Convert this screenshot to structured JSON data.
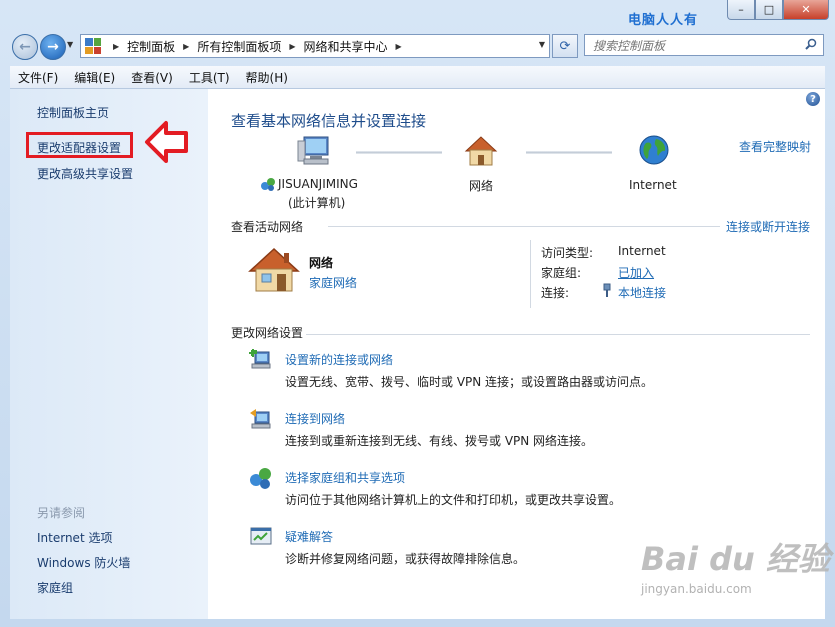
{
  "titlebar": {
    "watermark": "电脑人人有",
    "min": "–",
    "max": "□",
    "close": "✕"
  },
  "address": {
    "crumbs": [
      "控制面板",
      "所有控制面板项",
      "网络和共享中心"
    ]
  },
  "search": {
    "placeholder": "搜索控制面板"
  },
  "menu": [
    "文件(F)",
    "编辑(E)",
    "查看(V)",
    "工具(T)",
    "帮助(H)"
  ],
  "sidebar": {
    "home": "控制面板主页",
    "adapter": "更改适配器设置",
    "advanced": "更改高级共享设置",
    "see_also": "另请参阅",
    "internet_options": "Internet 选项",
    "firewall": "Windows 防火墙",
    "homegroup": "家庭组"
  },
  "main": {
    "heading": "查看基本网络信息并设置连接",
    "full_map": "查看完整映射",
    "computer_name": "JISUANJIMING",
    "computer_sub": "(此计算机)",
    "network_label": "网络",
    "internet_label": "Internet",
    "active_title": "查看活动网络",
    "connect_disconnect": "连接或断开连接",
    "active_name": "网络",
    "active_type": "家庭网络",
    "access_type_label": "访问类型:",
    "access_type_value": "Internet",
    "homegroup_label": "家庭组:",
    "homegroup_value": "已加入",
    "connection_label": "连接:",
    "connection_value": "本地连接",
    "change_title": "更改网络设置",
    "tasks": [
      {
        "title": "设置新的连接或网络",
        "desc": "设置无线、宽带、拨号、临时或 VPN 连接；或设置路由器或访问点。"
      },
      {
        "title": "连接到网络",
        "desc": "连接到或重新连接到无线、有线、拨号或 VPN 网络连接。"
      },
      {
        "title": "选择家庭组和共享选项",
        "desc": "访问位于其他网络计算机上的文件和打印机，或更改共享设置。"
      },
      {
        "title": "疑难解答",
        "desc": "诊断并修复网络问题，或获得故障排除信息。"
      }
    ]
  },
  "watermark": {
    "logo": "Bai du 经验",
    "url": "jingyan.baidu.com"
  }
}
